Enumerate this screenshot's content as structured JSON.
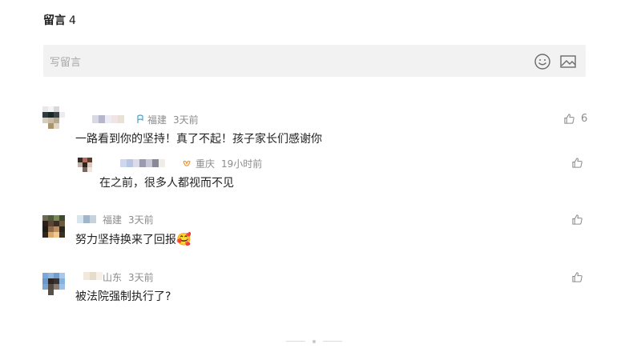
{
  "header": {
    "title": "留言",
    "count": "4"
  },
  "input": {
    "placeholder": "写留言",
    "emoji_icon": "emoji-icon",
    "image_icon": "image-icon"
  },
  "comments": [
    {
      "location": "福建",
      "time": "3天前",
      "text": "一路看到你的坚持！真了不起！孩子家长们感谢你",
      "likes": "6"
    },
    {
      "location": "重庆",
      "time": "19小时前",
      "text": "在之前，很多人都视而不见",
      "likes": ""
    },
    {
      "location": "福建",
      "time": "3天前",
      "text": "努力坚持换来了回报",
      "emoji": "🥰",
      "likes": ""
    },
    {
      "location": "山东",
      "time": "3天前",
      "text": "被法院强制执行了?",
      "likes": ""
    }
  ],
  "colors": {
    "accent": "#576b95",
    "meta": "#8c8c8c",
    "input_bg": "#f2f2f2"
  }
}
